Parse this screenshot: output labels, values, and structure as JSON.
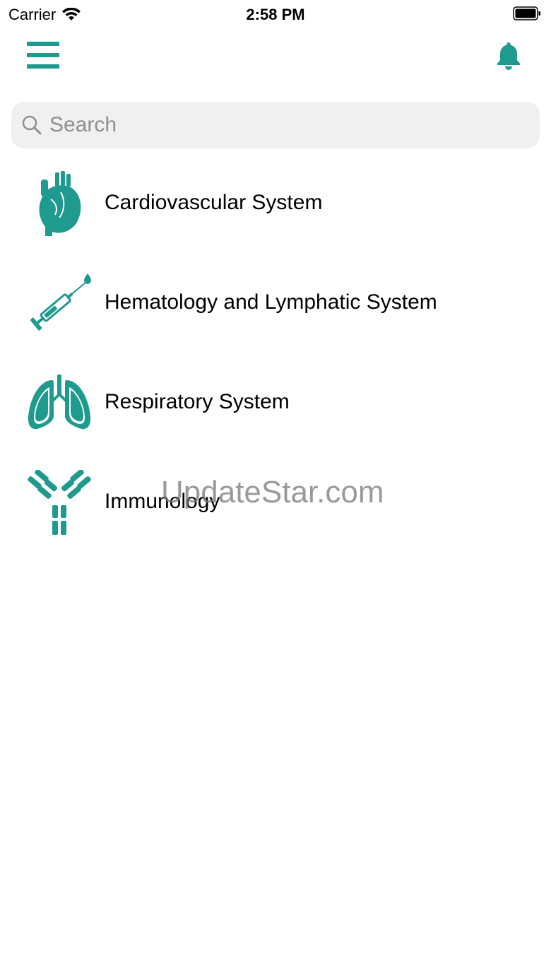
{
  "status_bar": {
    "carrier": "Carrier",
    "time": "2:58 PM"
  },
  "nav": {
    "menu_icon": "hamburger-menu-icon",
    "notification_icon": "bell-icon"
  },
  "search": {
    "placeholder": "Search",
    "value": ""
  },
  "categories": [
    {
      "label": "Cardiovascular System",
      "icon": "heart-icon"
    },
    {
      "label": "Hematology and Lymphatic System",
      "icon": "syringe-icon"
    },
    {
      "label": "Respiratory System",
      "icon": "lungs-icon"
    },
    {
      "label": "Immunology",
      "icon": "antibody-icon"
    }
  ],
  "watermark": "UpdateStar.com",
  "colors": {
    "accent": "#1f9a8f",
    "search_bg": "#f0f0f0",
    "placeholder": "#8e8e93"
  }
}
